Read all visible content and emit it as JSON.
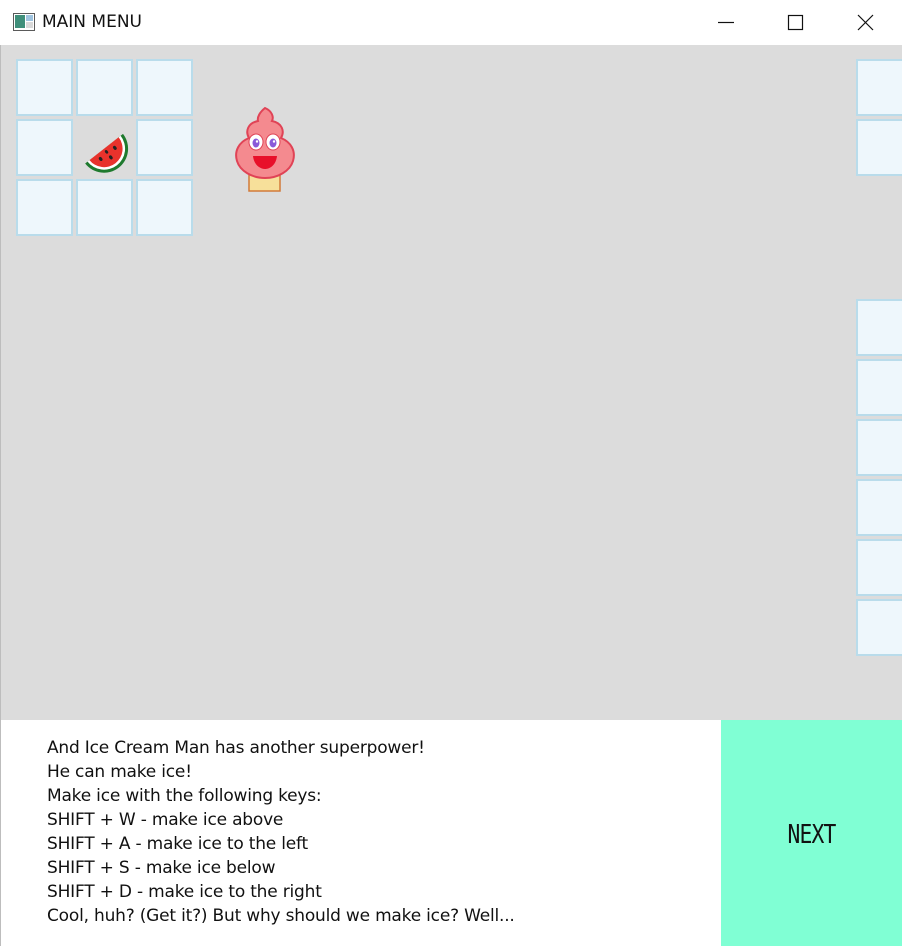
{
  "window": {
    "title": "MAIN MENU",
    "app_icon": "app-window-icon",
    "controls": [
      "minimize-icon",
      "maximize-icon",
      "close-icon"
    ]
  },
  "game": {
    "background_color": "#dcdcdc",
    "ice_block_color": "#eef7fc",
    "ice_border_color": "#b9dceb",
    "fruit": "watermelon-slice-icon",
    "player": "ice-cream-man-icon"
  },
  "dialog": {
    "lines": [
      "And Ice Cream Man has another superpower!",
      "He can make ice!",
      "Make ice with the following keys:",
      "SHIFT + W - make ice above",
      "SHIFT + A - make ice to the left",
      "SHIFT + S - make ice below",
      "SHIFT + D - make ice to the right",
      "Cool, huh? (Get it?) But why should we make ice? Well..."
    ]
  },
  "next_button": {
    "label": "NEXT",
    "color": "#80ffd4"
  }
}
